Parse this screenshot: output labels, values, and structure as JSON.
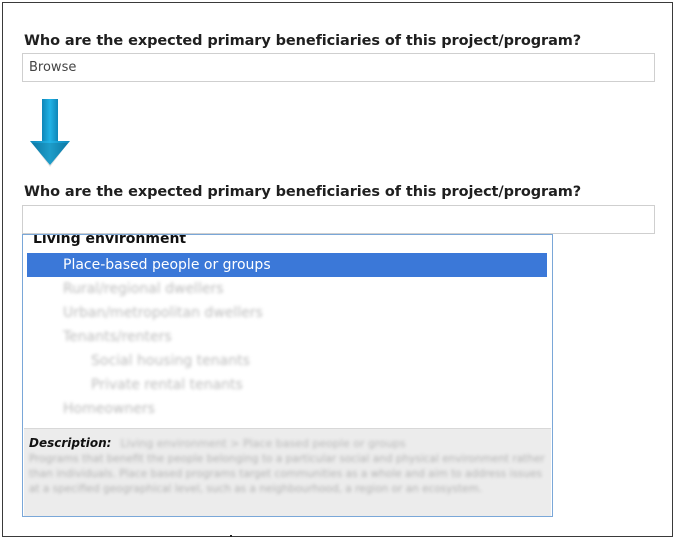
{
  "top_question": {
    "label": "Who are the expected primary beneficiaries of this project/program?",
    "field_value": "Browse"
  },
  "bottom_question": {
    "label": "Who are the expected primary beneficiaries of this project/program?",
    "field_value": ""
  },
  "arrow": {
    "icon": "down-arrow-icon",
    "color": "#1a9fd0"
  },
  "dropdown": {
    "group_header": "Living environment",
    "options": [
      {
        "label": "Place-based people or groups",
        "level": 1,
        "selected": true
      },
      {
        "label": "Rural/regional dwellers",
        "level": 1,
        "selected": false
      },
      {
        "label": "Urban/metropolitan dwellers",
        "level": 1,
        "selected": false
      },
      {
        "label": "Tenants/renters",
        "level": 1,
        "selected": false
      },
      {
        "label": "Social housing tenants",
        "level": 2,
        "selected": false
      },
      {
        "label": "Private rental tenants",
        "level": 2,
        "selected": false
      },
      {
        "label": "Homeowners",
        "level": 1,
        "selected": false
      }
    ],
    "description": {
      "label": "Description:",
      "heading": "Living environment > Place based people or groups",
      "body": "Programs that benefit the people belonging to a particular social and physical environment rather than individuals. Place based programs target communities as a whole and aim to address issues at a specified geographical level, such as a neighbourhood, a region or an ecosystem."
    },
    "selected_color": "#3b78d8"
  }
}
